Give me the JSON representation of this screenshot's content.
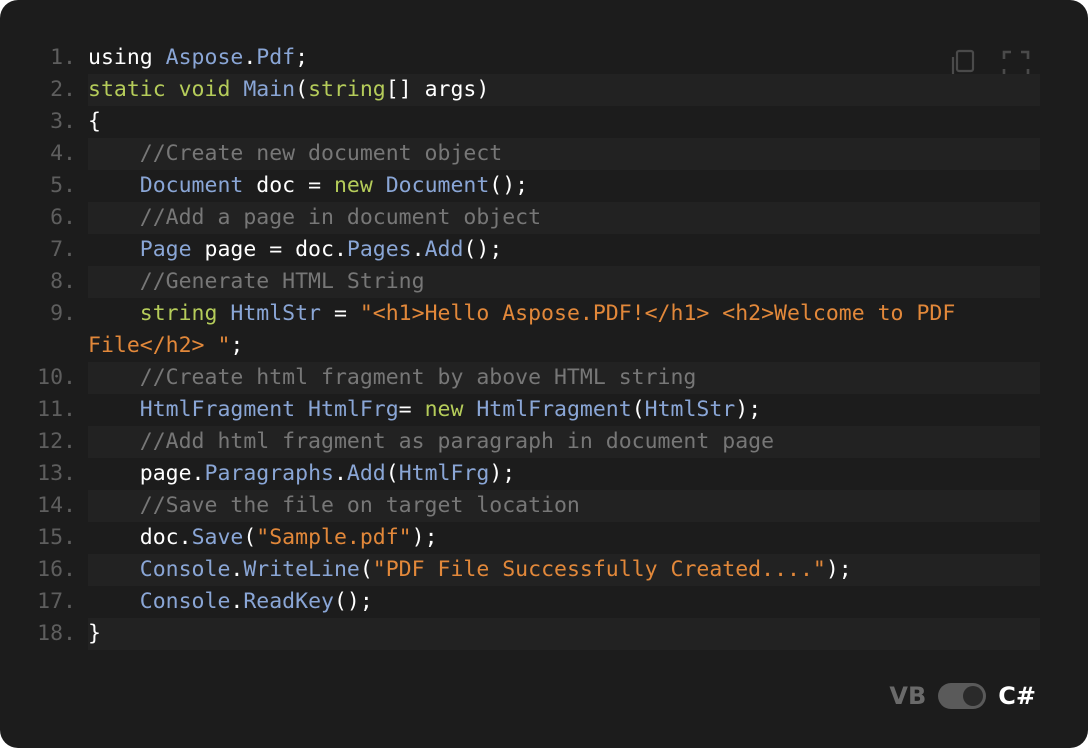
{
  "toolbar": {
    "copy_icon": "copy-icon",
    "fullscreen_icon": "fullscreen-icon"
  },
  "language_toggle": {
    "left_label": "VB",
    "right_label": "C#",
    "selected": "C#"
  },
  "colors": {
    "background": "#1c1c1c",
    "keyword": "#b5cc5a",
    "type": "#8aa6d6",
    "comment": "#777777",
    "string": "#e2883a",
    "line_number": "#5e5e5e"
  },
  "code_lines": [
    {
      "n": "1.",
      "tokens": [
        [
          "pl",
          "using "
        ],
        [
          "ty",
          "Aspose"
        ],
        [
          "pl",
          "."
        ],
        [
          "ty",
          "Pdf"
        ],
        [
          "pl",
          ";"
        ]
      ]
    },
    {
      "n": "2.",
      "tokens": [
        [
          "kw",
          "static void "
        ],
        [
          "ty",
          "Main"
        ],
        [
          "pl",
          "("
        ],
        [
          "kw",
          "string"
        ],
        [
          "pl",
          "[] args)"
        ]
      ]
    },
    {
      "n": "3.",
      "tokens": [
        [
          "pl",
          "{"
        ]
      ]
    },
    {
      "n": "4.",
      "tokens": [
        [
          "cm",
          "    //Create new document object"
        ]
      ]
    },
    {
      "n": "5.",
      "tokens": [
        [
          "pl",
          "    "
        ],
        [
          "ty",
          "Document"
        ],
        [
          "pl",
          " doc = "
        ],
        [
          "kw",
          "new "
        ],
        [
          "ty",
          "Document"
        ],
        [
          "pl",
          "();"
        ]
      ]
    },
    {
      "n": "6.",
      "tokens": [
        [
          "cm",
          "    //Add a page in document object"
        ]
      ]
    },
    {
      "n": "7.",
      "tokens": [
        [
          "pl",
          "    "
        ],
        [
          "ty",
          "Page"
        ],
        [
          "pl",
          " page = doc."
        ],
        [
          "ty",
          "Pages"
        ],
        [
          "pl",
          "."
        ],
        [
          "ty",
          "Add"
        ],
        [
          "pl",
          "();"
        ]
      ]
    },
    {
      "n": "8.",
      "tokens": [
        [
          "cm",
          "    //Generate HTML String"
        ]
      ]
    },
    {
      "n": "9.",
      "tokens": [
        [
          "pl",
          "    "
        ],
        [
          "kw",
          "string "
        ],
        [
          "ty",
          "HtmlStr"
        ],
        [
          "pl",
          " = "
        ],
        [
          "st",
          "\"<h1>Hello Aspose.PDF!</h1> <h2>Welcome to PDF File</h2> \""
        ],
        [
          "pl",
          ";"
        ]
      ]
    },
    {
      "n": "10.",
      "tokens": [
        [
          "cm",
          "    //Create html fragment by above HTML string"
        ]
      ]
    },
    {
      "n": "11.",
      "tokens": [
        [
          "pl",
          "    "
        ],
        [
          "ty",
          "HtmlFragment HtmlFrg"
        ],
        [
          "pl",
          "= "
        ],
        [
          "kw",
          "new "
        ],
        [
          "ty",
          "HtmlFragment"
        ],
        [
          "pl",
          "("
        ],
        [
          "ty",
          "HtmlStr"
        ],
        [
          "pl",
          ");"
        ]
      ]
    },
    {
      "n": "12.",
      "tokens": [
        [
          "cm",
          "    //Add html fragment as paragraph in document page"
        ]
      ]
    },
    {
      "n": "13.",
      "tokens": [
        [
          "pl",
          "    page."
        ],
        [
          "ty",
          "Paragraphs"
        ],
        [
          "pl",
          "."
        ],
        [
          "ty",
          "Add"
        ],
        [
          "pl",
          "("
        ],
        [
          "ty",
          "HtmlFrg"
        ],
        [
          "pl",
          ");"
        ]
      ]
    },
    {
      "n": "14.",
      "tokens": [
        [
          "cm",
          "    //Save the file on target location"
        ]
      ]
    },
    {
      "n": "15.",
      "tokens": [
        [
          "pl",
          "    doc."
        ],
        [
          "ty",
          "Save"
        ],
        [
          "pl",
          "("
        ],
        [
          "st",
          "\"Sample.pdf\""
        ],
        [
          "pl",
          ");"
        ]
      ]
    },
    {
      "n": "16.",
      "tokens": [
        [
          "pl",
          "    "
        ],
        [
          "ty",
          "Console"
        ],
        [
          "pl",
          "."
        ],
        [
          "ty",
          "WriteLine"
        ],
        [
          "pl",
          "("
        ],
        [
          "st",
          "\"PDF File Successfully Created....\""
        ],
        [
          "pl",
          ");"
        ]
      ]
    },
    {
      "n": "17.",
      "tokens": [
        [
          "pl",
          "    "
        ],
        [
          "ty",
          "Console"
        ],
        [
          "pl",
          "."
        ],
        [
          "ty",
          "ReadKey"
        ],
        [
          "pl",
          "();"
        ]
      ]
    },
    {
      "n": "18.",
      "tokens": [
        [
          "pl",
          "}"
        ]
      ]
    }
  ]
}
